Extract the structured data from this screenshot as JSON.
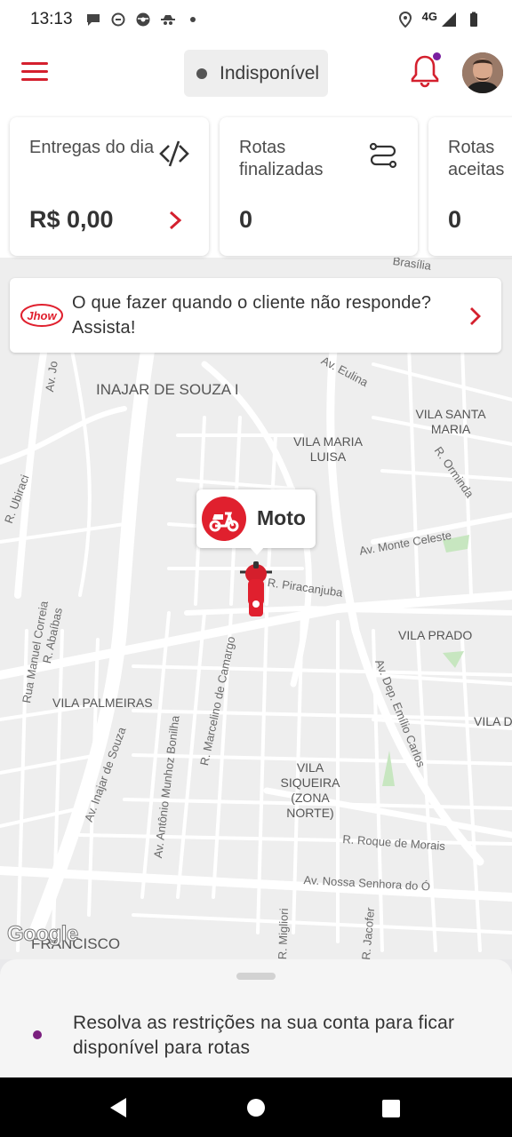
{
  "status_bar": {
    "time": "13:13",
    "network": "4G",
    "notification_icons": [
      "chat-bubble-icon",
      "sync-icon",
      "steering-wheel-icon",
      "incognito-icon",
      "dot-icon"
    ]
  },
  "header": {
    "availability_label": "Indisponível",
    "availability_color": "#555555",
    "accent_color": "#d4202e",
    "notification_badge_color": "#7a1fa0"
  },
  "cards": [
    {
      "title": "Entregas do dia",
      "value": "R$ 0,00",
      "icon": "hidden-eye-slash-icon",
      "has_chevron": true
    },
    {
      "title": "Rotas finalizadas",
      "value": "0",
      "icon": "route-icon",
      "has_chevron": false
    },
    {
      "title": "Rotas aceitas",
      "value": "0",
      "icon": "",
      "has_chevron": false
    }
  ],
  "tip": {
    "text": "O que fazer quando o cliente não responde? Assista!",
    "logo_text": "Jhow"
  },
  "map": {
    "vehicle_label": "Moto",
    "attribution": "Google",
    "areas": [
      "INAJAR DE SOUZA I",
      "VILA SANTA MARIA",
      "VILA MARIA LUISA",
      "VILA PRADO",
      "VILA PALMEIRAS",
      "VILA SIQUEIRA (ZONA NORTE)",
      "VILA D",
      "FRANCISCO"
    ],
    "streets": [
      "Av. Eulina",
      "R. Ubiraci",
      "R. Orminda",
      "Av. Monte Celeste",
      "R. Piracanjuba",
      "Rua Manuel Correia",
      "R. Abaíbas",
      "Av. Dep. Emílio Carlos",
      "Av. Inajar de Souza",
      "Av. Antônio Munhoz Bonilha",
      "R. Marcelino de Camargo",
      "R. Roque de Morais",
      "Av. Nossa Senhora do Ó",
      "Av. Jo",
      "R. Migliori",
      "R. Jacofer",
      "Brasília"
    ]
  },
  "bottom_sheet": {
    "message": "Resolva as restrições na sua conta para ficar disponível para rotas",
    "dot_color": "#7a1f7e"
  }
}
